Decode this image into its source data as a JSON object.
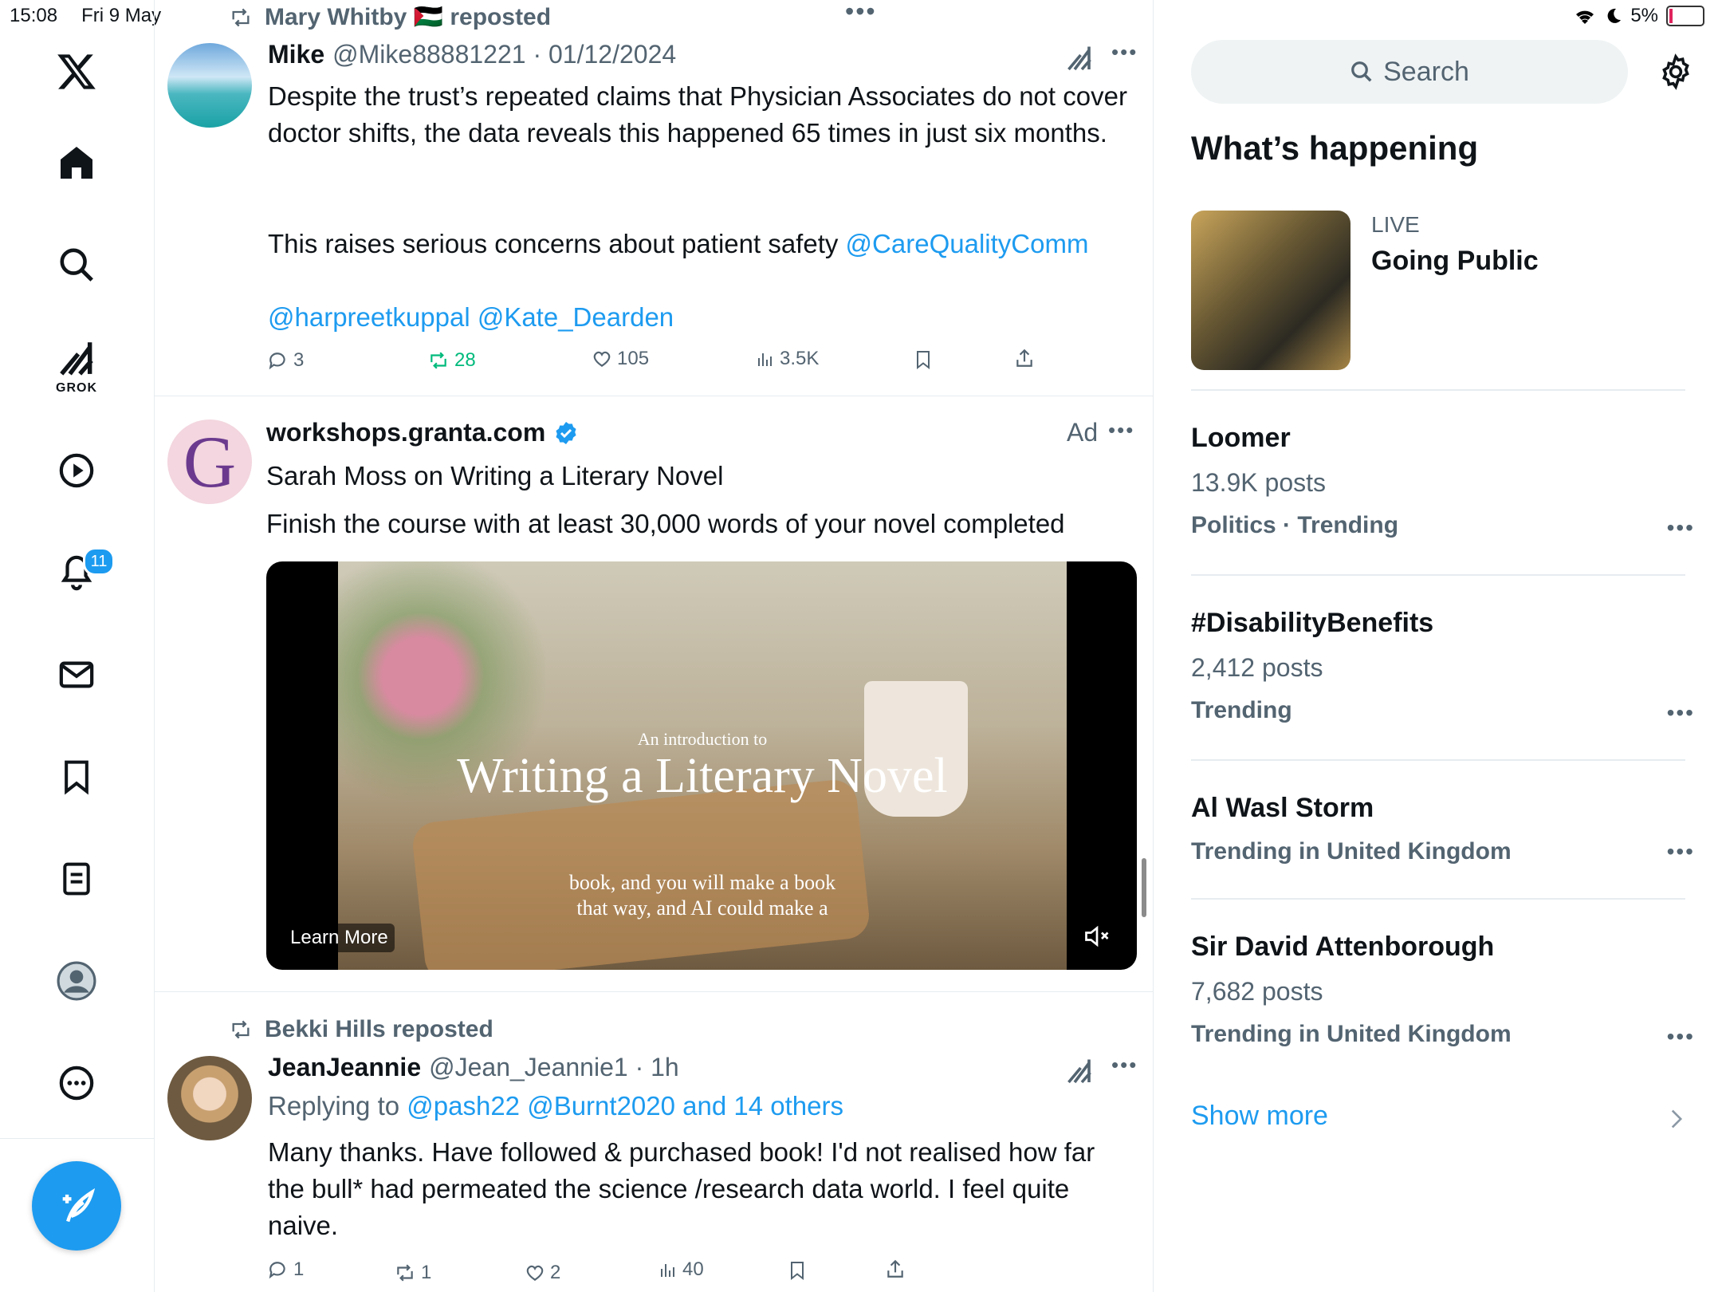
{
  "status_bar": {
    "time": "15:08",
    "date": "Fri 9 May",
    "battery": "5%"
  },
  "nav": {
    "grok_label": "GROK",
    "notifications_count": "11"
  },
  "feed": {
    "tweet1": {
      "repost_by": "Mary Whitby 🇵🇸 reposted",
      "name": "Mike",
      "handle_date": "@Mike88881221 · 01/12/2024",
      "text_p1": "Despite the trust’s repeated claims that Physician Associates do not cover doctor shifts, the data reveals this happened 65 times in just six months.",
      "text_p2": "This raises serious concerns about patient safety ",
      "mention1": "@CareQualityComm",
      "mention2": "@harpreetkuppal @Kate_Dearden",
      "replies": "3",
      "reposts": "28",
      "likes": "105",
      "views": "3.5K"
    },
    "ad": {
      "name": "workshops.granta.com",
      "ad_label": "Ad",
      "title": "Sarah Moss on Writing a Literary Novel",
      "body": "Finish the course with at least 30,000 words of your novel completed",
      "media_intro": "An introduction to",
      "media_title": "Writing a Literary Novel",
      "media_caption1": "book, and you will make a book",
      "media_caption2": "that way, and AI could make a",
      "learn_more": "Learn More"
    },
    "tweet2": {
      "repost_by": "Bekki Hills reposted",
      "name": "JeanJeannie",
      "handle_time": "@Jean_Jeannie1 · 1h",
      "replying_prefix": "Replying to ",
      "replying_to": "@pash22 @Burnt2020 and 14 others",
      "text": "Many thanks. Have followed & purchased book! I'd not realised how far the bull* had permeated the science /research data world. I feel quite naive.",
      "replies": "1",
      "reposts": "1",
      "likes": "2",
      "views": "40"
    }
  },
  "sidebar": {
    "search_placeholder": "Search",
    "section_title": "What’s happening",
    "live": {
      "label": "LIVE",
      "title": "Going Public"
    },
    "trends": [
      {
        "title": "Loomer",
        "posts": "13.9K posts",
        "context": "Politics · Trending"
      },
      {
        "title": "#DisabilityBenefits",
        "posts": "2,412 posts",
        "context": "Trending"
      },
      {
        "title": "Al Wasl Storm",
        "context": "Trending in United Kingdom"
      },
      {
        "title": "Sir David Attenborough",
        "posts": "7,682 posts",
        "context": "Trending in United Kingdom"
      }
    ],
    "show_more": "Show more"
  }
}
